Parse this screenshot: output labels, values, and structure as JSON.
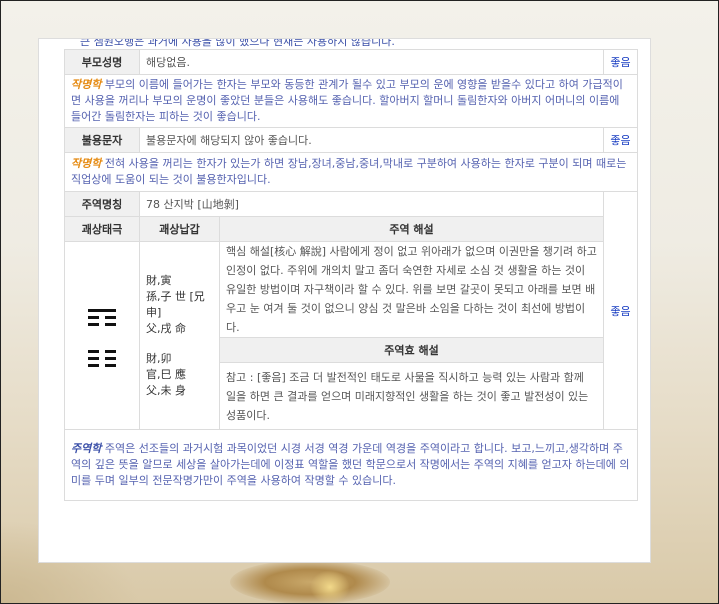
{
  "header_cut_text": "큰 샘원오행은 과거에 사용을 많이 했으나 현재는 사용하지 않습니다.",
  "rows": {
    "bumo": {
      "label": "부모성명",
      "value": "해당없음.",
      "rating": "좋음",
      "note_kw": "작명학",
      "note": "부모의 이름에 들어가는 한자는 부모와 동등한 관계가 될수 있고 부모의 운에 영향을 받을수 있다고 하여 가급적이면 사용을 꺼리나 부모의 운명이 좋았던 분들은 사용해도 좋습니다. 할아버지 할머니 돌림한자와 아버지 어머니의 이름에 들어간 돌림한자는 피하는 것이 좋습니다."
    },
    "bulyong": {
      "label": "불용문자",
      "value": "불용문자에 해당되지 않아 좋습니다.",
      "rating": "좋음",
      "note_kw": "작명학",
      "note": "전혀 사용을 꺼리는 한자가 있는가 하면 장남,장녀,중남,중녀,막내로 구분하여 사용하는 한자로 구분이 되며 때로는 직업상에 도움이 되는 것이 불용한자입니다."
    },
    "juyeok": {
      "label": "주역명칭",
      "value": "78 산지박 [山地剝]",
      "rating": "좋음",
      "col_taegwae": "괘상태극",
      "col_napgap": "괘상납갑",
      "col_haeseol": "주역 해설",
      "napgap_group1": [
        "財,寅",
        "孫,子 世 [兄申]",
        "父,戌 命"
      ],
      "napgap_group2": [
        "財,卯",
        "官,巳 應",
        "父,未 身"
      ],
      "haeseol": "핵심 해설[核心 解說] 사람에게 정이 없고 위아래가 없으며 이권만을 챙기려 하고 인정이 없다. 주위에 개의치 말고 좀더 숙연한 자세로 소심 것 생활을 하는 것이 유일한 방법이며 자구책이라 할 수 있다. 위를 보면 갈곳이 못되고 아래를 보면 배우고 눈 여겨 둘 것이 없으니 양심 것 말은바 소임을 다하는 것이 최선에 방법이다.",
      "hyo_title": "주역효 해설",
      "hyo_text": "참고 : [좋음] 조금 더 발전적인 태도로 사물을 직시하고 능력 있는 사람과 함께 일을 하면 큰 결과를 얻으며 미래지향적인 생활을 하는 것이 좋고 발전성이 있는 성품이다.",
      "note_kw": "주역학",
      "note": "주역은 선조들의 과거시험 과목이었던 시경 서경 역경 가운데 역경을 주역이라고 합니다. 보고,느끼고,생각하며 주역의 깊은 뜻을 알므로 세상을 살아가는데에 이정표 역할을 했던 학문으로서 작명에서는 주역의 지혜를 얻고자 하는데에 의미를 두며 일부의 전문작명가만이 주역을 사용하여 작명할 수 있습니다."
    }
  },
  "hexagram_lines": [
    "solid",
    "split",
    "split",
    "split",
    "split",
    "split"
  ]
}
